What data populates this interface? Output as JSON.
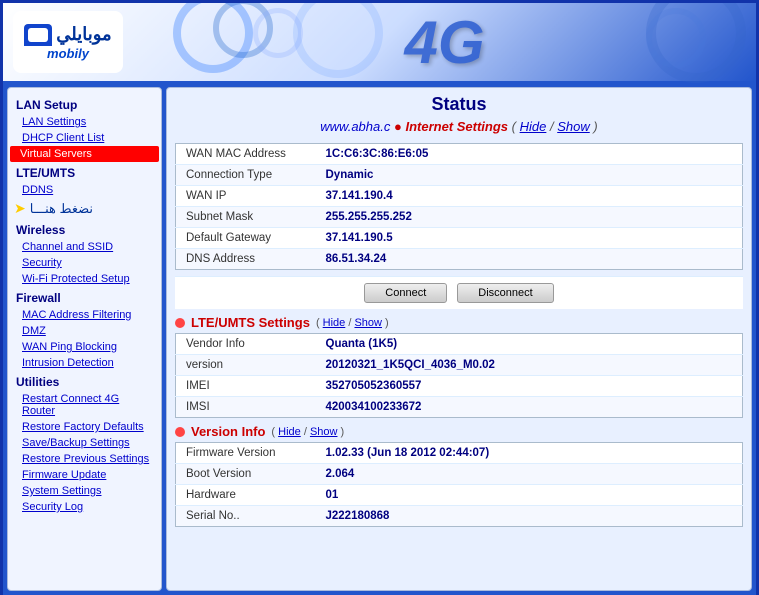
{
  "header": {
    "logo_arabic": "موبايلي",
    "logo_english": "mobily",
    "logo_g": "4G",
    "url": "www.abha.c"
  },
  "sidebar": {
    "sections": [
      {
        "label": "LAN Setup",
        "items": [
          {
            "id": "lan-settings",
            "label": "LAN Settings",
            "active": false
          },
          {
            "id": "dhcp-client-list",
            "label": "DHCP Client List",
            "active": false
          },
          {
            "id": "virtual-servers",
            "label": "Virtual Servers",
            "active": true
          }
        ]
      },
      {
        "label": "LTE/UMTS",
        "items": [
          {
            "id": "ddns",
            "label": "DDNS",
            "active": false
          }
        ]
      },
      {
        "label": "Wireless",
        "items": [
          {
            "id": "channel-ssid",
            "label": "Channel and SSID",
            "active": false
          },
          {
            "id": "security",
            "label": "Security",
            "active": false
          },
          {
            "id": "wifi-protected",
            "label": "Wi-Fi Protected Setup",
            "active": false
          }
        ]
      },
      {
        "label": "Firewall",
        "items": [
          {
            "id": "mac-filtering",
            "label": "MAC Address Filtering",
            "active": false
          },
          {
            "id": "dmz",
            "label": "DMZ",
            "active": false
          },
          {
            "id": "wan-ping",
            "label": "WAN Ping Blocking",
            "active": false
          },
          {
            "id": "intrusion",
            "label": "Intrusion Detection",
            "active": false
          }
        ]
      },
      {
        "label": "Utilities",
        "items": [
          {
            "id": "restart-connect",
            "label": "Restart Connect 4G Router",
            "active": false
          },
          {
            "id": "restore-factory",
            "label": "Restore Factory Defaults",
            "active": false
          },
          {
            "id": "save-backup",
            "label": "Save/Backup Settings",
            "active": false
          },
          {
            "id": "restore-previous",
            "label": "Restore Previous Settings",
            "active": false
          },
          {
            "id": "firmware-update",
            "label": "Firmware Update",
            "active": false
          },
          {
            "id": "system-settings",
            "label": "System Settings",
            "active": false
          },
          {
            "id": "security-log",
            "label": "Security Log",
            "active": false
          }
        ]
      }
    ]
  },
  "content": {
    "status_title": "Status",
    "url_display": "www.abha.c",
    "arabic_label": "نضغط هنـــا",
    "internet_settings": {
      "title": "Internet Settings",
      "hide": "Hide",
      "show": "Show",
      "rows": [
        {
          "label": "WAN MAC Address",
          "value": "1C:C6:3C:86:E6:05"
        },
        {
          "label": "Connection Type",
          "value": "Dynamic"
        },
        {
          "label": "WAN IP",
          "value": "37.141.190.4"
        },
        {
          "label": "Subnet Mask",
          "value": "255.255.255.252"
        },
        {
          "label": "Default Gateway",
          "value": "37.141.190.5"
        },
        {
          "label": "DNS Address",
          "value": "86.51.34.24"
        }
      ],
      "btn_connect": "Connect",
      "btn_disconnect": "Disconnect"
    },
    "lte_umts": {
      "title": "LTE/UMTS Settings",
      "hide": "Hide",
      "show": "Show",
      "rows": [
        {
          "label": "Vendor Info",
          "value": "Quanta (1K5)"
        },
        {
          "label": "version",
          "value": "20120321_1K5QCI_4036_M0.02"
        },
        {
          "label": "IMEI",
          "value": "352705052360557"
        },
        {
          "label": "IMSI",
          "value": "420034100233672"
        }
      ]
    },
    "version_info": {
      "title": "Version Info",
      "hide": "Hide",
      "show": "Show",
      "rows": [
        {
          "label": "Firmware Version",
          "value": "1.02.33 (Jun 18 2012 02:44:07)"
        },
        {
          "label": "Boot Version",
          "value": "2.064"
        },
        {
          "label": "Hardware",
          "value": "01"
        },
        {
          "label": "Serial No..",
          "value": "J222180868"
        }
      ]
    }
  }
}
